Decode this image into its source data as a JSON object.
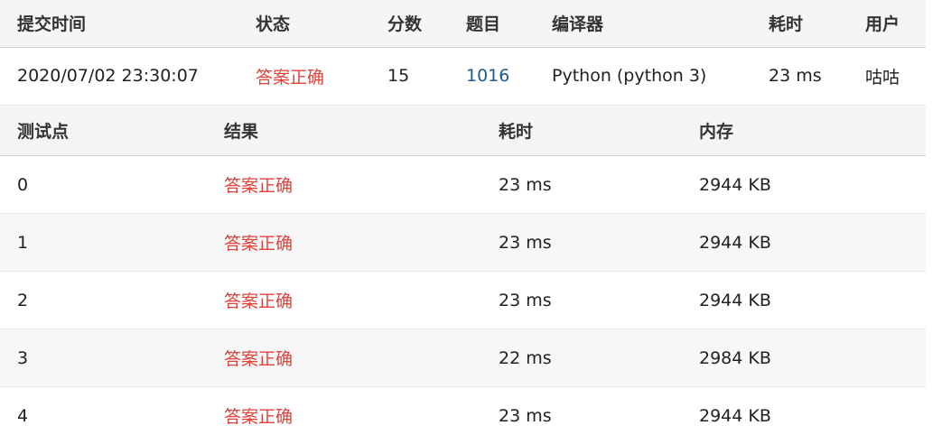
{
  "submission": {
    "headers": [
      "提交时间",
      "状态",
      "分数",
      "题目",
      "编译器",
      "耗时",
      "用户"
    ],
    "row": {
      "time": "2020/07/02 23:30:07",
      "status": "答案正确",
      "score": "15",
      "problem": "1016",
      "compiler": "Python (python 3)",
      "elapsed": "23 ms",
      "user": "咕咕"
    }
  },
  "testcases": {
    "headers": [
      "测试点",
      "结果",
      "耗时",
      "内存"
    ],
    "rows": [
      {
        "id": "0",
        "result": "答案正确",
        "time": "23 ms",
        "memory": "2944 KB"
      },
      {
        "id": "1",
        "result": "答案正确",
        "time": "23 ms",
        "memory": "2944 KB"
      },
      {
        "id": "2",
        "result": "答案正确",
        "time": "23 ms",
        "memory": "2944 KB"
      },
      {
        "id": "3",
        "result": "答案正确",
        "time": "22 ms",
        "memory": "2984 KB"
      },
      {
        "id": "4",
        "result": "答案正确",
        "time": "23 ms",
        "memory": "2944 KB"
      }
    ]
  },
  "colors": {
    "accepted": "#e0423a",
    "link": "#1e5a8c",
    "header_bg": "#f5f5f5"
  }
}
